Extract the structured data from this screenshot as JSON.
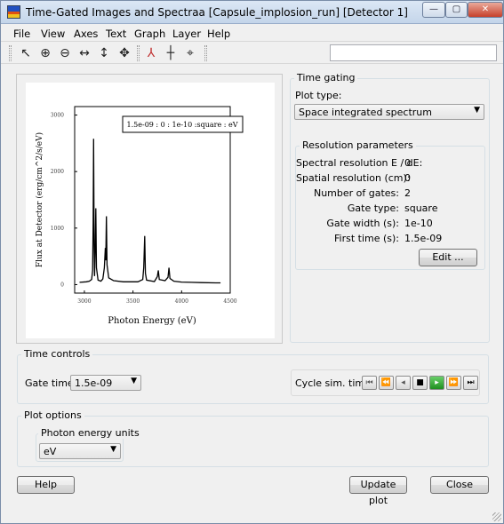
{
  "window": {
    "title": "Time-Gated Images and Spectraa [Capsule_implosion_run] [Detector 1]",
    "min_glyph": "—",
    "max_glyph": "▢",
    "close_glyph": "✕"
  },
  "menubar": [
    "File",
    "View",
    "Axes",
    "Text",
    "Graph",
    "Layer",
    "Help"
  ],
  "toolbar": {
    "icons": [
      "pointer-icon",
      "zoom-in-icon",
      "zoom-out-icon",
      "pan-horizontal-icon",
      "pan-vertical-icon",
      "pan-all-icon",
      "axes-icon",
      "crosshair-icon",
      "target-icon"
    ],
    "glyphs": [
      "↖",
      "⊕",
      "⊖",
      "↔",
      "↕",
      "✥",
      "⅄",
      "┼",
      "⌖"
    ],
    "field_value": ""
  },
  "chart_data": {
    "type": "line",
    "title": "",
    "legend": "1.5e-09 : 0 : 1e-10 :square : eV",
    "xlabel": "Photon Energy (eV)",
    "ylabel": "Flux at Detector (erg/cm^2/s/eV)",
    "x_ticks": [
      "3000",
      "3500",
      "4000",
      "4500"
    ],
    "y_ticks": [
      "0",
      "1000",
      "2000",
      "3000"
    ],
    "xlim": [
      2900,
      4500
    ],
    "ylim": [
      -150,
      3150
    ],
    "points": [
      [
        2950,
        40
      ],
      [
        3020,
        50
      ],
      [
        3050,
        60
      ],
      [
        3075,
        90
      ],
      [
        3085,
        250
      ],
      [
        3090,
        1100
      ],
      [
        3095,
        2580
      ],
      [
        3100,
        700
      ],
      [
        3105,
        150
      ],
      [
        3112,
        700
      ],
      [
        3118,
        1350
      ],
      [
        3124,
        300
      ],
      [
        3140,
        80
      ],
      [
        3170,
        60
      ],
      [
        3190,
        100
      ],
      [
        3205,
        300
      ],
      [
        3215,
        650
      ],
      [
        3220,
        430
      ],
      [
        3226,
        1210
      ],
      [
        3233,
        350
      ],
      [
        3250,
        120
      ],
      [
        3300,
        70
      ],
      [
        3400,
        50
      ],
      [
        3550,
        50
      ],
      [
        3600,
        90
      ],
      [
        3610,
        300
      ],
      [
        3620,
        860
      ],
      [
        3628,
        200
      ],
      [
        3640,
        80
      ],
      [
        3720,
        55
      ],
      [
        3750,
        140
      ],
      [
        3760,
        250
      ],
      [
        3770,
        90
      ],
      [
        3830,
        70
      ],
      [
        3860,
        130
      ],
      [
        3870,
        300
      ],
      [
        3880,
        110
      ],
      [
        3920,
        60
      ],
      [
        4000,
        45
      ],
      [
        4100,
        40
      ],
      [
        4200,
        35
      ],
      [
        4350,
        30
      ],
      [
        4400,
        30
      ]
    ],
    "colors": {
      "line": "#000000"
    }
  },
  "time_gating": {
    "title": "Time gating",
    "plot_type_label": "Plot type:",
    "plot_type_value": "Space integrated spectrum",
    "resolution": {
      "title": "Resolution parameters",
      "rows": [
        {
          "label": "Spectral resolution E / dE:",
          "value": "0"
        },
        {
          "label": "Spatial resolution (cm):",
          "value": "0"
        },
        {
          "label": "Number of gates:",
          "value": "2"
        },
        {
          "label": "Gate type:",
          "value": "square"
        },
        {
          "label": "Gate width (s):",
          "value": "1e-10"
        },
        {
          "label": "First time (s):",
          "value": "1.5e-09"
        }
      ],
      "edit_label": "Edit ..."
    }
  },
  "time_controls": {
    "title": "Time controls",
    "gate_time_label": "Gate time:",
    "gate_time_value": "1.5e-09",
    "cycle_label": "Cycle sim. time:",
    "cycle_icons": [
      "skip-to-start-icon",
      "rewind-icon",
      "step-back-icon",
      "stop-icon",
      "step-forward-icon",
      "fast-forward-icon",
      "skip-to-end-icon"
    ],
    "cycle_glyphs": [
      "⏮",
      "⏪",
      "◂",
      "■",
      "▸",
      "⏩",
      "⏭"
    ]
  },
  "plot_options": {
    "title": "Plot options",
    "units_title": "Photon energy units",
    "units_value": "eV"
  },
  "buttons": {
    "help": "Help",
    "update_plot": "Update plot",
    "close": "Close"
  },
  "combo_arrow": "▼"
}
